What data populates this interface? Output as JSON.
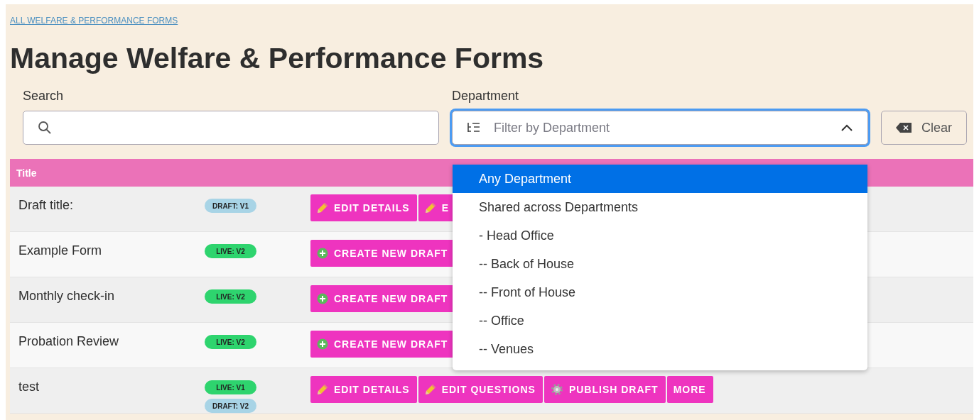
{
  "breadcrumb": "ALL WELFARE & PERFORMANCE FORMS",
  "heading": "Manage Welfare & Performance Forms",
  "search": {
    "label": "Search"
  },
  "department": {
    "label": "Department",
    "placeholder": "Filter by Department",
    "expanded": true,
    "options": [
      {
        "label": "Any Department",
        "selected": true
      },
      {
        "label": "Shared across Departments",
        "selected": false
      },
      {
        "label": "- Head Office",
        "selected": false
      },
      {
        "label": "-- Back of House",
        "selected": false
      },
      {
        "label": "-- Front of House",
        "selected": false
      },
      {
        "label": "-- Office",
        "selected": false
      },
      {
        "label": "-- Venues",
        "selected": false
      }
    ]
  },
  "clear_button": "Clear",
  "table": {
    "columns": [
      "Title"
    ],
    "rows": [
      {
        "title": "Draft title:",
        "badges": [
          {
            "label": "DRAFT: V1",
            "kind": "draft"
          }
        ],
        "actions": [
          {
            "label": "EDIT DETAILS",
            "kind": "edit"
          },
          {
            "label": "E",
            "kind": "edit"
          }
        ]
      },
      {
        "title": "Example Form",
        "badges": [
          {
            "label": "LIVE: V2",
            "kind": "live"
          }
        ],
        "actions": [
          {
            "label": "CREATE NEW DRAFT",
            "kind": "create"
          }
        ]
      },
      {
        "title": "Monthly check-in",
        "badges": [
          {
            "label": "LIVE: V2",
            "kind": "live"
          }
        ],
        "actions": [
          {
            "label": "CREATE NEW DRAFT",
            "kind": "create"
          }
        ]
      },
      {
        "title": "Probation Review",
        "badges": [
          {
            "label": "LIVE: V2",
            "kind": "live"
          }
        ],
        "actions": [
          {
            "label": "CREATE NEW DRAFT",
            "kind": "create"
          }
        ]
      },
      {
        "title": "test",
        "badges": [
          {
            "label": "LIVE: V1",
            "kind": "live"
          },
          {
            "label": "DRAFT: V2",
            "kind": "draft"
          }
        ],
        "actions": [
          {
            "label": "EDIT DETAILS",
            "kind": "edit"
          },
          {
            "label": "EDIT QUESTIONS",
            "kind": "edit"
          },
          {
            "label": "PUBLISH DRAFT",
            "kind": "publish"
          },
          {
            "label": "MORE",
            "kind": "more"
          }
        ]
      }
    ]
  }
}
